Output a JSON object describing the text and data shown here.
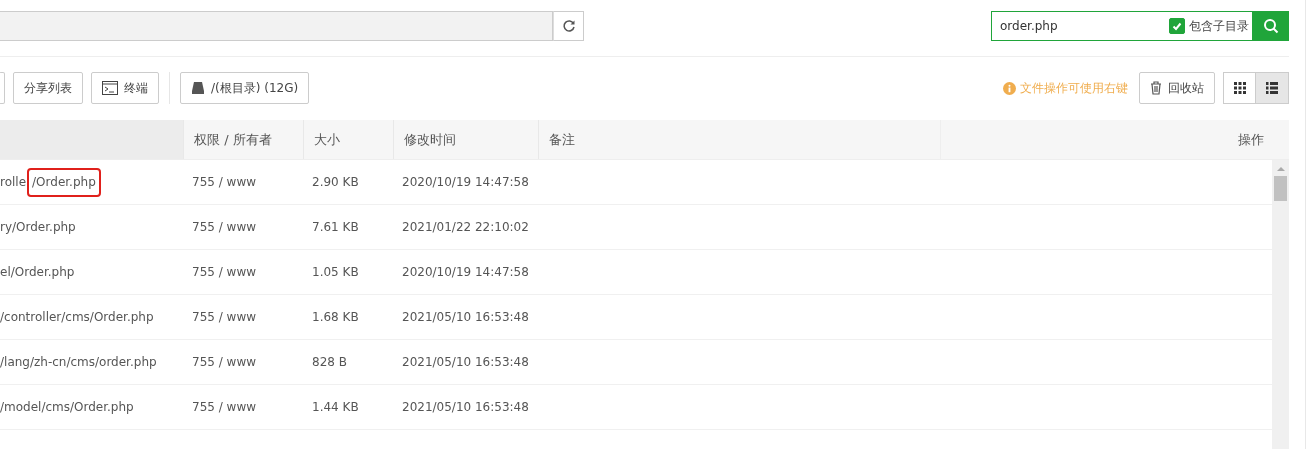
{
  "search": {
    "value": "order.php",
    "include_subdirs": {
      "label": "包含子目录",
      "checked": true
    }
  },
  "toolbar": {
    "buttons": [
      {
        "kind": "plain",
        "label": "分享列表"
      },
      {
        "kind": "terminal",
        "label": "终端"
      },
      {
        "kind": "disk",
        "label": "/(根目录) (12G)"
      }
    ],
    "hint": "文件操作可使用右键",
    "recycle_bin": "回收站",
    "views": [
      {
        "kind": "grid",
        "selected": false
      },
      {
        "kind": "list",
        "selected": true
      }
    ]
  },
  "table": {
    "columns": [
      "",
      "权限 / 所有者",
      "大小",
      "修改时间",
      "备注",
      "操作"
    ],
    "rows": [
      {
        "path": "rolle",
        "highlight": "/Order.php",
        "permission": "755 / www",
        "size": "2.90 KB",
        "modified": "2020/10/19 14:47:58"
      },
      {
        "path": "ry/Order.php",
        "permission": "755 / www",
        "size": "7.61 KB",
        "modified": "2021/01/22 22:10:02"
      },
      {
        "path": "el/Order.php",
        "permission": "755 / www",
        "size": "1.05 KB",
        "modified": "2020/10/19 14:47:58"
      },
      {
        "path": "/controller/cms/Order.php",
        "permission": "755 / www",
        "size": "1.68 KB",
        "modified": "2021/05/10 16:53:48"
      },
      {
        "path": "/lang/zh-cn/cms/order.php",
        "permission": "755 / www",
        "size": "828 B",
        "modified": "2021/05/10 16:53:48"
      },
      {
        "path": "/model/cms/Order.php",
        "permission": "755 / www",
        "size": "1.44 KB",
        "modified": "2021/05/10 16:53:48"
      }
    ]
  }
}
